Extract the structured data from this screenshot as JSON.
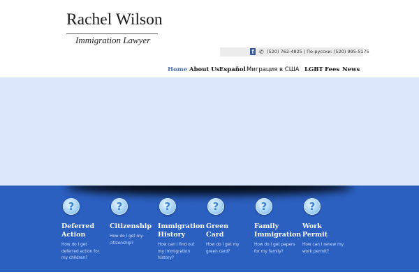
{
  "logo": {
    "name": "Rachel Wilson",
    "tagline": "Immigration Lawyer"
  },
  "contact": {
    "facebook_icon": "facebook-icon",
    "phone_icon": "phone-icon",
    "text": "(520) 762-4825 | По-русски: (520) 995-5175"
  },
  "nav": [
    {
      "label": "Home"
    },
    {
      "label": "About Us"
    },
    {
      "label": "Español"
    },
    {
      "label": "Миграция в США"
    },
    {
      "label": "LGBT"
    },
    {
      "label": "Fees"
    },
    {
      "label": "News"
    }
  ],
  "cards": [
    {
      "icon": "question-icon",
      "title": "Deferred Action",
      "desc": "How do I get deferred action for my children?"
    },
    {
      "icon": "question-icon",
      "title": "Citizenship",
      "desc": "How do I get my citizenship?"
    },
    {
      "icon": "question-icon",
      "title": "Immigration History",
      "desc": "How can I find out my immigration history?"
    },
    {
      "icon": "question-icon",
      "title": "Green Card",
      "desc": "How do I get my green card?"
    },
    {
      "icon": "question-icon",
      "title": "Family Immigration",
      "desc": "How do I get papers for my family?"
    },
    {
      "icon": "question-icon",
      "title": "Work Permit",
      "desc": "How can I renew my work permit?"
    }
  ],
  "colors": {
    "accent": "#4a6fb8",
    "band": "#2b5fc0",
    "hero": "#dbe7fb"
  }
}
